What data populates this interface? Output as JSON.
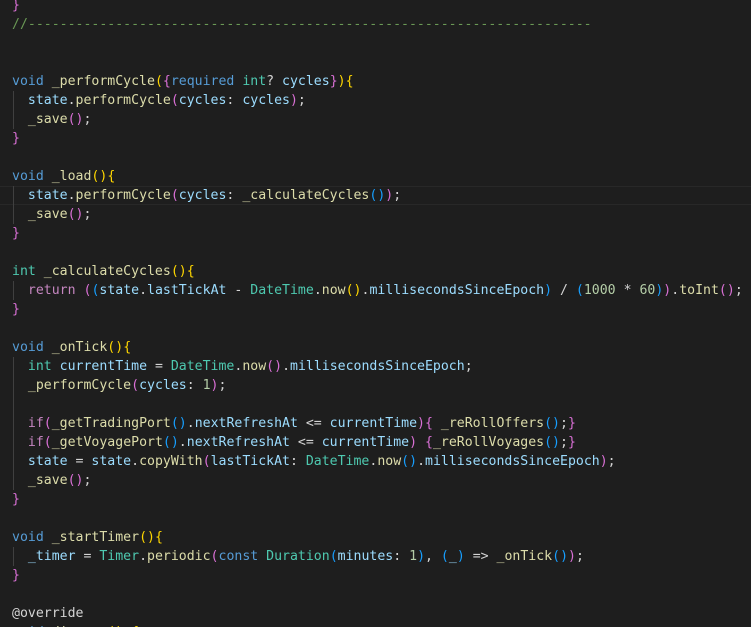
{
  "editor": {
    "language": "dart",
    "theme_colors": {
      "background": "#1e1e1e",
      "plain": "#d4d4d4",
      "keyword": "#569cd6",
      "control": "#c586c0",
      "function": "#dcdcaa",
      "type": "#4ec9b0",
      "variable": "#9cdcfe",
      "number": "#b5cea8",
      "comment": "#6a9955",
      "bracket1": "#ffd700",
      "bracket2": "#da70d6",
      "bracket3": "#179fff"
    },
    "lines": [
      [
        {
          "t": "}",
          "c": "bracket2"
        }
      ],
      [
        {
          "t": "//-----------------------------------------------------------------------",
          "c": "comment"
        }
      ],
      [],
      [],
      [
        {
          "t": "void",
          "c": "keyword"
        },
        {
          "t": " "
        },
        {
          "t": "_performCycle",
          "c": "function"
        },
        {
          "t": "(",
          "c": "bracket1"
        },
        {
          "t": "{",
          "c": "bracket2"
        },
        {
          "t": "required",
          "c": "keyword"
        },
        {
          "t": " "
        },
        {
          "t": "int",
          "c": "type"
        },
        {
          "t": "? "
        },
        {
          "t": "cycles",
          "c": "variable"
        },
        {
          "t": "}",
          "c": "bracket2"
        },
        {
          "t": ")",
          "c": "bracket1"
        },
        {
          "t": "{",
          "c": "bracket1"
        }
      ],
      [
        {
          "t": "  "
        },
        {
          "t": "state",
          "c": "variable"
        },
        {
          "t": "."
        },
        {
          "t": "performCycle",
          "c": "function"
        },
        {
          "t": "(",
          "c": "bracket2"
        },
        {
          "t": "cycles",
          "c": "variable"
        },
        {
          "t": ": "
        },
        {
          "t": "cycles",
          "c": "variable"
        },
        {
          "t": ")",
          "c": "bracket2"
        },
        {
          "t": ";"
        }
      ],
      [
        {
          "t": "  "
        },
        {
          "t": "_save",
          "c": "function"
        },
        {
          "t": "(",
          "c": "bracket2"
        },
        {
          "t": ")",
          "c": "bracket2"
        },
        {
          "t": ";"
        }
      ],
      [
        {
          "t": "}",
          "c": "bracket2"
        }
      ],
      [],
      [
        {
          "t": "void",
          "c": "keyword"
        },
        {
          "t": " "
        },
        {
          "t": "_load",
          "c": "function"
        },
        {
          "t": "(",
          "c": "bracket1"
        },
        {
          "t": ")",
          "c": "bracket1"
        },
        {
          "t": "{",
          "c": "bracket1"
        }
      ],
      [
        {
          "t": "  "
        },
        {
          "t": "state",
          "c": "variable"
        },
        {
          "t": "."
        },
        {
          "t": "performCycle",
          "c": "function"
        },
        {
          "t": "(",
          "c": "bracket2"
        },
        {
          "t": "cycles",
          "c": "variable"
        },
        {
          "t": ": "
        },
        {
          "t": "_calculateCycles",
          "c": "function"
        },
        {
          "t": "(",
          "c": "bracket3"
        },
        {
          "t": ")",
          "c": "bracket3"
        },
        {
          "t": ")",
          "c": "bracket2"
        },
        {
          "t": ";"
        }
      ],
      [
        {
          "t": "  "
        },
        {
          "t": "_save",
          "c": "function"
        },
        {
          "t": "(",
          "c": "bracket2"
        },
        {
          "t": ")",
          "c": "bracket2"
        },
        {
          "t": ";"
        }
      ],
      [
        {
          "t": "}",
          "c": "bracket2"
        }
      ],
      [],
      [
        {
          "t": "int",
          "c": "type"
        },
        {
          "t": " "
        },
        {
          "t": "_calculateCycles",
          "c": "function"
        },
        {
          "t": "(",
          "c": "bracket1"
        },
        {
          "t": ")",
          "c": "bracket1"
        },
        {
          "t": "{",
          "c": "bracket1"
        }
      ],
      [
        {
          "t": "  "
        },
        {
          "t": "return",
          "c": "control"
        },
        {
          "t": " "
        },
        {
          "t": "(",
          "c": "bracket2"
        },
        {
          "t": "(",
          "c": "bracket3"
        },
        {
          "t": "state",
          "c": "variable"
        },
        {
          "t": "."
        },
        {
          "t": "lastTickAt",
          "c": "variable"
        },
        {
          "t": " - "
        },
        {
          "t": "DateTime",
          "c": "type"
        },
        {
          "t": "."
        },
        {
          "t": "now",
          "c": "function"
        },
        {
          "t": "(",
          "c": "bracket1"
        },
        {
          "t": ")",
          "c": "bracket1"
        },
        {
          "t": "."
        },
        {
          "t": "millisecondsSinceEpoch",
          "c": "variable"
        },
        {
          "t": ")",
          "c": "bracket3"
        },
        {
          "t": " / "
        },
        {
          "t": "(",
          "c": "bracket3"
        },
        {
          "t": "1000",
          "c": "number"
        },
        {
          "t": " * "
        },
        {
          "t": "60",
          "c": "number"
        },
        {
          "t": ")",
          "c": "bracket3"
        },
        {
          "t": ")",
          "c": "bracket2"
        },
        {
          "t": "."
        },
        {
          "t": "toInt",
          "c": "function"
        },
        {
          "t": "(",
          "c": "bracket2"
        },
        {
          "t": ")",
          "c": "bracket2"
        },
        {
          "t": ";"
        }
      ],
      [
        {
          "t": "}",
          "c": "bracket2"
        }
      ],
      [],
      [
        {
          "t": "void",
          "c": "keyword"
        },
        {
          "t": " "
        },
        {
          "t": "_onTick",
          "c": "function"
        },
        {
          "t": "(",
          "c": "bracket1"
        },
        {
          "t": ")",
          "c": "bracket1"
        },
        {
          "t": "{",
          "c": "bracket1"
        }
      ],
      [
        {
          "t": "  "
        },
        {
          "t": "int",
          "c": "type"
        },
        {
          "t": " "
        },
        {
          "t": "currentTime",
          "c": "variable"
        },
        {
          "t": " = "
        },
        {
          "t": "DateTime",
          "c": "type"
        },
        {
          "t": "."
        },
        {
          "t": "now",
          "c": "function"
        },
        {
          "t": "(",
          "c": "bracket2"
        },
        {
          "t": ")",
          "c": "bracket2"
        },
        {
          "t": "."
        },
        {
          "t": "millisecondsSinceEpoch",
          "c": "variable"
        },
        {
          "t": ";"
        }
      ],
      [
        {
          "t": "  "
        },
        {
          "t": "_performCycle",
          "c": "function"
        },
        {
          "t": "(",
          "c": "bracket2"
        },
        {
          "t": "cycles",
          "c": "variable"
        },
        {
          "t": ": "
        },
        {
          "t": "1",
          "c": "number"
        },
        {
          "t": ")",
          "c": "bracket2"
        },
        {
          "t": ";"
        }
      ],
      [],
      [
        {
          "t": "  "
        },
        {
          "t": "if",
          "c": "control"
        },
        {
          "t": "(",
          "c": "bracket2"
        },
        {
          "t": "_getTradingPort",
          "c": "function"
        },
        {
          "t": "(",
          "c": "bracket3"
        },
        {
          "t": ")",
          "c": "bracket3"
        },
        {
          "t": "."
        },
        {
          "t": "nextRefreshAt",
          "c": "variable"
        },
        {
          "t": " <= "
        },
        {
          "t": "currentTime",
          "c": "variable"
        },
        {
          "t": ")",
          "c": "bracket2"
        },
        {
          "t": "{",
          "c": "bracket2"
        },
        {
          "t": " "
        },
        {
          "t": "_reRollOffers",
          "c": "function"
        },
        {
          "t": "(",
          "c": "bracket3"
        },
        {
          "t": ")",
          "c": "bracket3"
        },
        {
          "t": ";"
        },
        {
          "t": "}",
          "c": "bracket2"
        }
      ],
      [
        {
          "t": "  "
        },
        {
          "t": "if",
          "c": "control"
        },
        {
          "t": "(",
          "c": "bracket2"
        },
        {
          "t": "_getVoyagePort",
          "c": "function"
        },
        {
          "t": "(",
          "c": "bracket3"
        },
        {
          "t": ")",
          "c": "bracket3"
        },
        {
          "t": "."
        },
        {
          "t": "nextRefreshAt",
          "c": "variable"
        },
        {
          "t": " <= "
        },
        {
          "t": "currentTime",
          "c": "variable"
        },
        {
          "t": ")",
          "c": "bracket2"
        },
        {
          "t": " "
        },
        {
          "t": "{",
          "c": "bracket2"
        },
        {
          "t": "_reRollVoyages",
          "c": "function"
        },
        {
          "t": "(",
          "c": "bracket3"
        },
        {
          "t": ")",
          "c": "bracket3"
        },
        {
          "t": ";"
        },
        {
          "t": "}",
          "c": "bracket2"
        }
      ],
      [
        {
          "t": "  "
        },
        {
          "t": "state",
          "c": "variable"
        },
        {
          "t": " = "
        },
        {
          "t": "state",
          "c": "variable"
        },
        {
          "t": "."
        },
        {
          "t": "copyWith",
          "c": "function"
        },
        {
          "t": "(",
          "c": "bracket2"
        },
        {
          "t": "lastTickAt",
          "c": "variable"
        },
        {
          "t": ": "
        },
        {
          "t": "DateTime",
          "c": "type"
        },
        {
          "t": "."
        },
        {
          "t": "now",
          "c": "function"
        },
        {
          "t": "(",
          "c": "bracket3"
        },
        {
          "t": ")",
          "c": "bracket3"
        },
        {
          "t": "."
        },
        {
          "t": "millisecondsSinceEpoch",
          "c": "variable"
        },
        {
          "t": ")",
          "c": "bracket2"
        },
        {
          "t": ";"
        }
      ],
      [
        {
          "t": "  "
        },
        {
          "t": "_save",
          "c": "function"
        },
        {
          "t": "(",
          "c": "bracket2"
        },
        {
          "t": ")",
          "c": "bracket2"
        },
        {
          "t": ";"
        }
      ],
      [
        {
          "t": "}",
          "c": "bracket2"
        }
      ],
      [],
      [
        {
          "t": "void",
          "c": "keyword"
        },
        {
          "t": " "
        },
        {
          "t": "_startTimer",
          "c": "function"
        },
        {
          "t": "(",
          "c": "bracket1"
        },
        {
          "t": ")",
          "c": "bracket1"
        },
        {
          "t": "{",
          "c": "bracket1"
        }
      ],
      [
        {
          "t": "  "
        },
        {
          "t": "_timer",
          "c": "variable"
        },
        {
          "t": " = "
        },
        {
          "t": "Timer",
          "c": "type"
        },
        {
          "t": "."
        },
        {
          "t": "periodic",
          "c": "function"
        },
        {
          "t": "(",
          "c": "bracket2"
        },
        {
          "t": "const",
          "c": "keyword"
        },
        {
          "t": " "
        },
        {
          "t": "Duration",
          "c": "type"
        },
        {
          "t": "(",
          "c": "bracket3"
        },
        {
          "t": "minutes",
          "c": "variable"
        },
        {
          "t": ": "
        },
        {
          "t": "1",
          "c": "number"
        },
        {
          "t": ")",
          "c": "bracket3"
        },
        {
          "t": ", "
        },
        {
          "t": "(",
          "c": "bracket3"
        },
        {
          "t": "_",
          "c": "variable"
        },
        {
          "t": ")",
          "c": "bracket3"
        },
        {
          "t": " => "
        },
        {
          "t": "_onTick",
          "c": "function"
        },
        {
          "t": "(",
          "c": "bracket3"
        },
        {
          "t": ")",
          "c": "bracket3"
        },
        {
          "t": ")",
          "c": "bracket2"
        },
        {
          "t": ";"
        }
      ],
      [
        {
          "t": "}",
          "c": "bracket2"
        }
      ],
      [],
      [
        {
          "t": "@override",
          "c": "plain"
        }
      ],
      [
        {
          "t": "void",
          "c": "keyword"
        },
        {
          "t": " "
        },
        {
          "t": "dispose",
          "c": "function"
        },
        {
          "t": "(",
          "c": "bracket1"
        },
        {
          "t": ")",
          "c": "bracket1"
        },
        {
          "t": " "
        },
        {
          "t": "{",
          "c": "bracket1"
        }
      ]
    ]
  }
}
